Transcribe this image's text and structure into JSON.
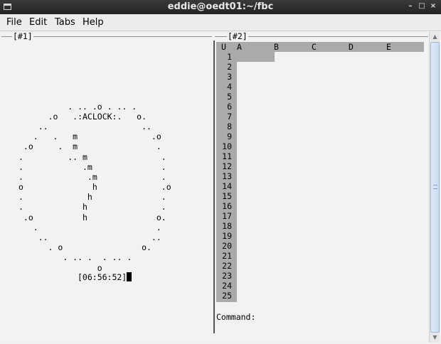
{
  "window": {
    "title": "eddie@oedt01:~/fbc",
    "controls": {
      "minimize": "–",
      "maximize": "□",
      "close": "×"
    }
  },
  "menu": [
    "File",
    "Edit",
    "Tabs",
    "Help"
  ],
  "left_pane": {
    "tag": "[#1]",
    "clock_lines": [
      "          . .. .o . .. .",
      "      .o   .:ACLOCK:.   o.",
      "    ..                   ..",
      "   .   .   m               .o",
      " .o     .  m                .",
      ".         .. m               .",
      ".            .m              .",
      ".             .m             .",
      "o              h             .o",
      ".             h              .",
      ".            h               .",
      " .o          h              o.",
      "   .                        .",
      "    ..                     ..",
      "      . o                o.",
      "         . .. .  . .. .",
      "                o"
    ],
    "time": "[06:56:52]"
  },
  "right_pane": {
    "tag": "[#2]",
    "corner": "U",
    "columns": [
      "A",
      "B",
      "C",
      "D",
      "E"
    ],
    "rows": [
      "1",
      "2",
      "3",
      "4",
      "5",
      "6",
      "7",
      "8",
      "9",
      "10",
      "11",
      "12",
      "13",
      "14",
      "15",
      "16",
      "17",
      "18",
      "19",
      "20",
      "21",
      "22",
      "23",
      "24",
      "25"
    ],
    "command_label": "Command:"
  },
  "scrollbar": {
    "up": "▲",
    "down": "▼"
  }
}
